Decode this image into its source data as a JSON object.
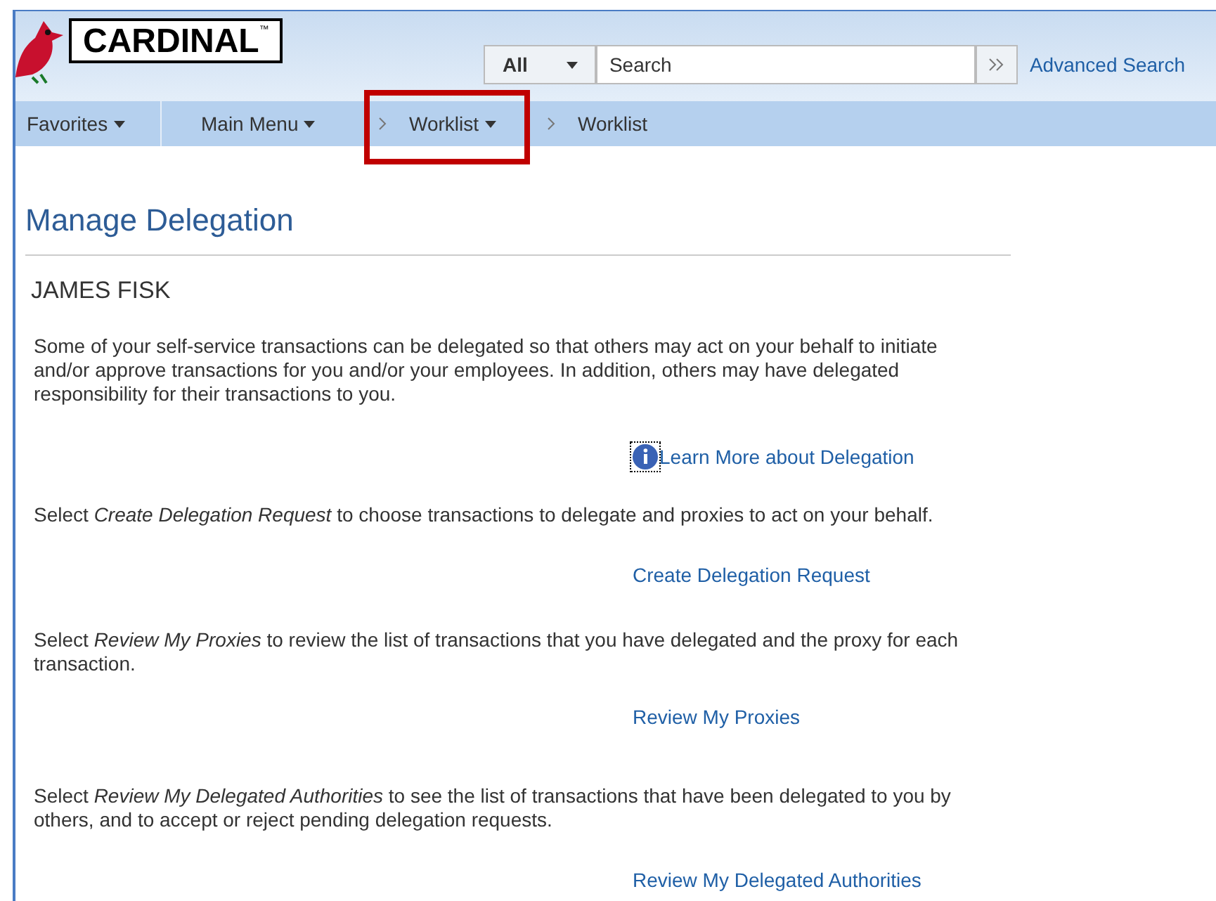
{
  "header": {
    "logo": "CARDINAL",
    "logo_mark": "™",
    "search_scope": "All",
    "search": {
      "placeholder": "Search"
    },
    "advanced_search": "Advanced Search"
  },
  "nav": [
    {
      "label": "Favorites",
      "kind": "menu",
      "highlighted": false
    },
    {
      "label": "Main Menu",
      "kind": "menu",
      "highlighted": false
    },
    {
      "label": "Worklist",
      "kind": "crumb-menu",
      "highlighted": true
    },
    {
      "label": "Worklist",
      "kind": "crumb",
      "highlighted": false
    }
  ],
  "page": {
    "title": "Manage Delegation",
    "user": "JAMES FISK",
    "intro": "Some of your self-service transactions can be delegated so that others may act on your behalf to initiate and/or approve transactions for you and/or your employees. In addition, others may have delegated responsibility for their transactions to you.",
    "learn_more": "Learn More about Delegation",
    "sections": [
      {
        "text": "Select *Create Delegation Request* to choose transactions to delegate and proxies to act on your behalf.",
        "link": "Create Delegation Request"
      },
      {
        "text": "Select *Review My Proxies* to review the list of transactions that you have delegated and the proxy for each transaction.",
        "link": "Review My Proxies"
      },
      {
        "text": "Select *Review My Delegated Authorities* to see the list of transactions that have been delegated to you by others, and to accept or reject pending delegation requests.",
        "link": "Review My Delegated Authorities"
      }
    ]
  }
}
